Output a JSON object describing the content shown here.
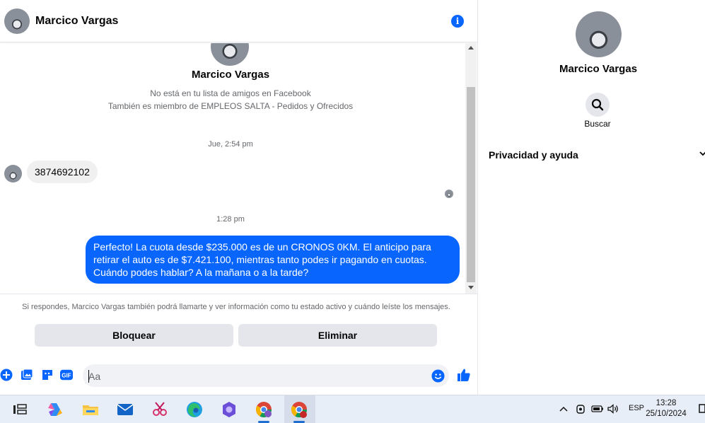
{
  "header": {
    "name": "Marcico Vargas",
    "info_icon": "info-icon"
  },
  "intro": {
    "name": "Marcico Vargas",
    "line1": "No está en tu lista de amigos en Facebook",
    "line2": "También es miembro de EMPLEOS SALTA - Pedidos y Ofrecidos"
  },
  "messages": [
    {
      "timestamp": "Jue, 2:54 pm",
      "direction": "incoming",
      "text": "3874692102"
    },
    {
      "timestamp": "1:28 pm",
      "direction": "outgoing",
      "text": "Perfecto! La cuota desde $235.000 es de un CRONOS 0KM. El anticipo para retirar el auto es de $7.421.100, mientras tanto podes ir pagando en cuotas. Cuándo podes hablar? A la mañana o a la tarde?"
    }
  ],
  "notice": "Si respondes, Marcico Vargas también podrá llamarte y ver información como tu estado activo y cuándo leíste los mensajes.",
  "actions": {
    "block": "Bloquear",
    "delete": "Eliminar"
  },
  "composer": {
    "placeholder": "Aa",
    "gif_label": "GIF"
  },
  "panel": {
    "name": "Marcico Vargas",
    "search_label": "Buscar",
    "privacy_label": "Privacidad y ayuda"
  },
  "taskbar": {
    "language": "ESP",
    "time": "13:28",
    "date": "25/10/2024",
    "apps": [
      "task-view-icon",
      "copilot-icon",
      "file-explorer-icon",
      "mail-icon",
      "snipping-tool-icon",
      "edge-icon",
      "teams-icon",
      "chrome-profile-icon",
      "chrome-icon"
    ]
  },
  "colors": {
    "accent": "#0866ff",
    "bubble_in": "#f0f0f0",
    "button_bg": "#e4e6eb",
    "taskbar": "#e8eef7"
  }
}
